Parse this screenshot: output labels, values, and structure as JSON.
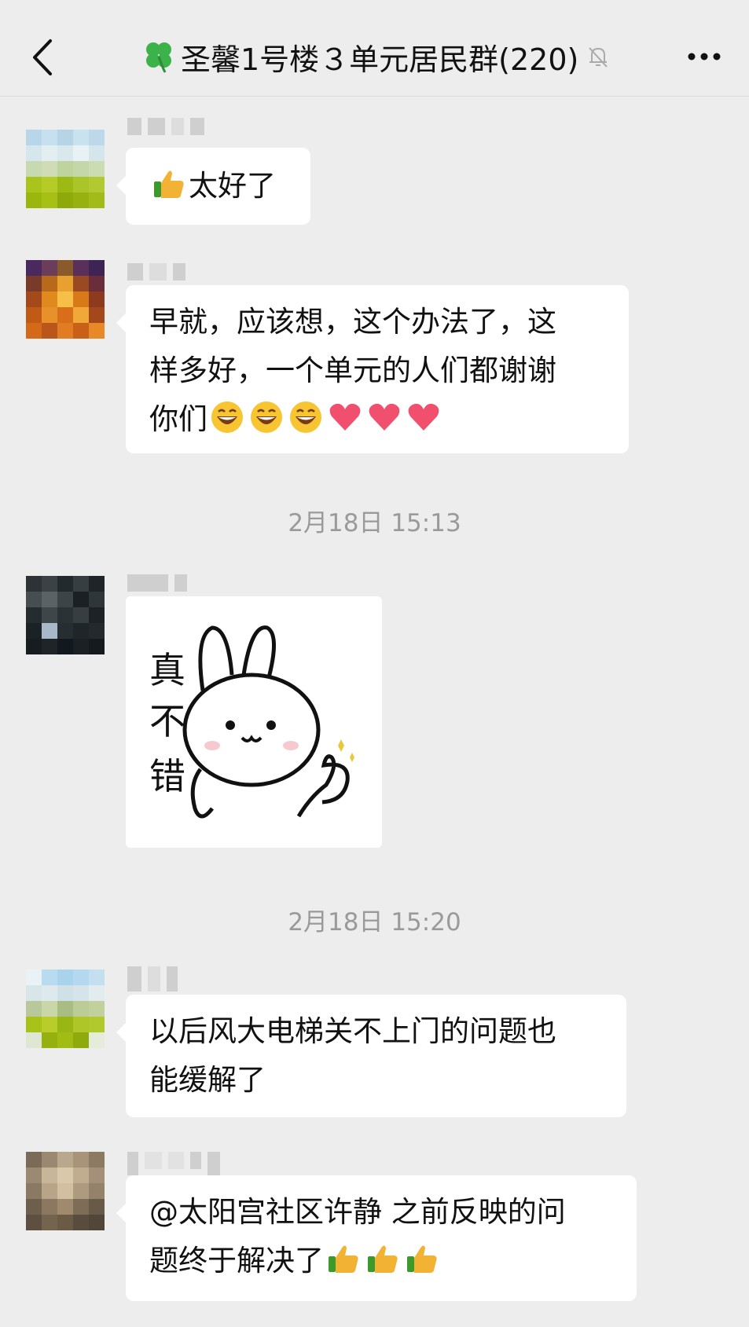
{
  "header": {
    "title": "圣馨1号楼３单元居民群(220)",
    "back_icon": "chevron-left-icon",
    "clover_icon": "four-leaf-clover-icon",
    "mute_icon": "bell-slash-icon",
    "more_icon": "ellipsis-icon"
  },
  "messages": [
    {
      "text": "太好了"
    },
    {
      "line1": "早就，应该想，这个办法了，这",
      "line2": "样多好，一个单元的人们都谢谢",
      "line3": "你们"
    },
    {
      "sticker_text": [
        "真",
        "不",
        "错"
      ]
    },
    {
      "line1": "以后风大电梯关不上门的问题也",
      "line2": "能缓解了"
    },
    {
      "line1": "@太阳宫社区许静 之前反映的问",
      "line2": "题终于解决了"
    }
  ],
  "timestamps": [
    "2月18日 15:13",
    "2月18日 15:20"
  ],
  "colors": {
    "background": "#ededed",
    "bubble": "#ffffff",
    "timestamp": "#9a9a9a"
  }
}
